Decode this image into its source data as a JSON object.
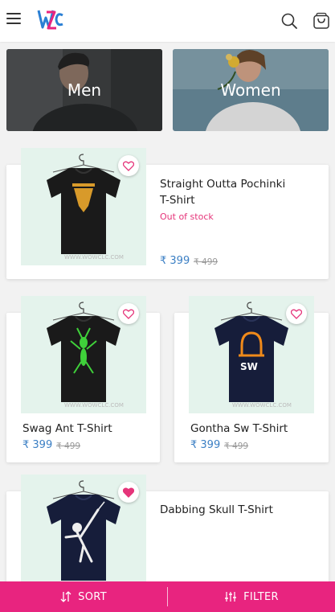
{
  "header": {
    "logo": "WZC",
    "menu_icon": "menu-icon",
    "search_icon": "search-icon",
    "bag_icon": "shopping-bag-icon"
  },
  "categories": [
    {
      "label": "Men"
    },
    {
      "label": "Women"
    }
  ],
  "products": [
    {
      "title_line1": "Straight Outta Pochinki",
      "title_line2": "T-Shirt",
      "status": "Out of stock",
      "price": "₹ 399",
      "old_price": "₹ 499",
      "wishlisted": false
    },
    {
      "title": "Swag Ant T-Shirt",
      "price": "₹ 399",
      "old_price": "₹ 499",
      "wishlisted": false
    },
    {
      "title": "Gontha Sw T-Shirt",
      "price": "₹ 399",
      "old_price": "₹ 499",
      "wishlisted": false
    },
    {
      "title": "Dabbing Skull T-Shirt",
      "wishlisted": true
    }
  ],
  "bottom_bar": {
    "sort_label": "SORT",
    "filter_label": "FILTER"
  },
  "colors": {
    "accent": "#e8247f",
    "price": "#3b7fc4",
    "heart": "#e5357a"
  }
}
